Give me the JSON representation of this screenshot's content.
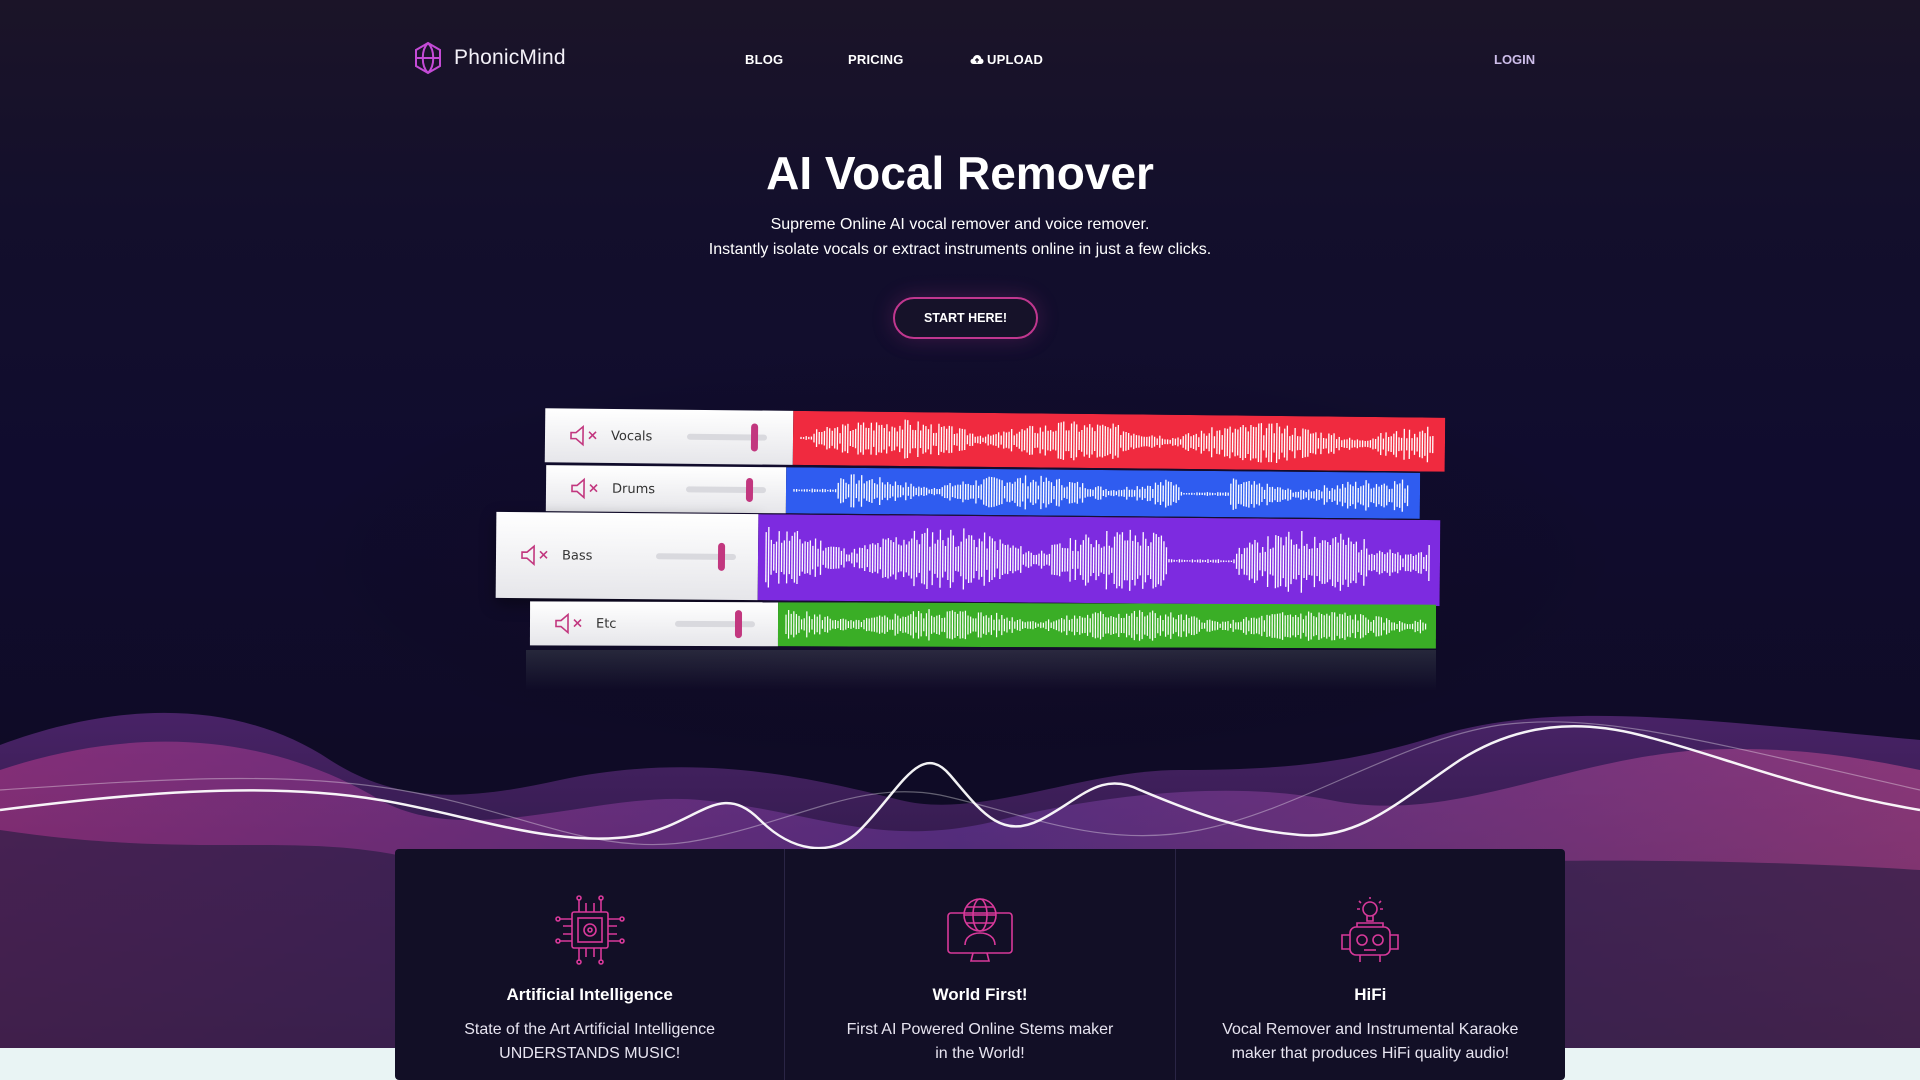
{
  "brand": {
    "name": "PhonicMind",
    "accent": "#c0378f"
  },
  "nav": {
    "items": [
      {
        "label": "BLOG"
      },
      {
        "label": "PRICING"
      },
      {
        "label": "UPLOAD",
        "icon": "cloud-upload-icon"
      }
    ],
    "login": "LOGIN"
  },
  "hero": {
    "title": "AI Vocal Remover",
    "subtitle_line1": "Supreme Online AI vocal remover and voice remover.",
    "subtitle_line2": "Instantly isolate vocals or extract instruments online in just a few clicks.",
    "cta": "START HERE!"
  },
  "stems": [
    {
      "label": "Vocals",
      "color": "#f02a3f",
      "icon": "mute-speaker-icon"
    },
    {
      "label": "Drums",
      "color": "#2f5cf0",
      "icon": "mute-speaker-icon"
    },
    {
      "label": "Bass",
      "color": "#7d2be0",
      "icon": "mute-speaker-icon"
    },
    {
      "label": "Etc",
      "color": "#3aae26",
      "icon": "mute-speaker-icon"
    }
  ],
  "features": [
    {
      "title": "Artificial Intelligence",
      "line1": "State of the Art Artificial Intelligence",
      "line2": "UNDERSTANDS MUSIC!",
      "icon": "chip-icon"
    },
    {
      "title": "World First!",
      "line1": "First AI Powered Online Stems maker",
      "line2": "in the World!",
      "icon": "globe-monitor-icon"
    },
    {
      "title": "HiFi",
      "line1": "Vocal Remover and Instrumental Karaoke",
      "line2": "maker that produces HiFi quality audio!",
      "icon": "robot-icon"
    }
  ]
}
